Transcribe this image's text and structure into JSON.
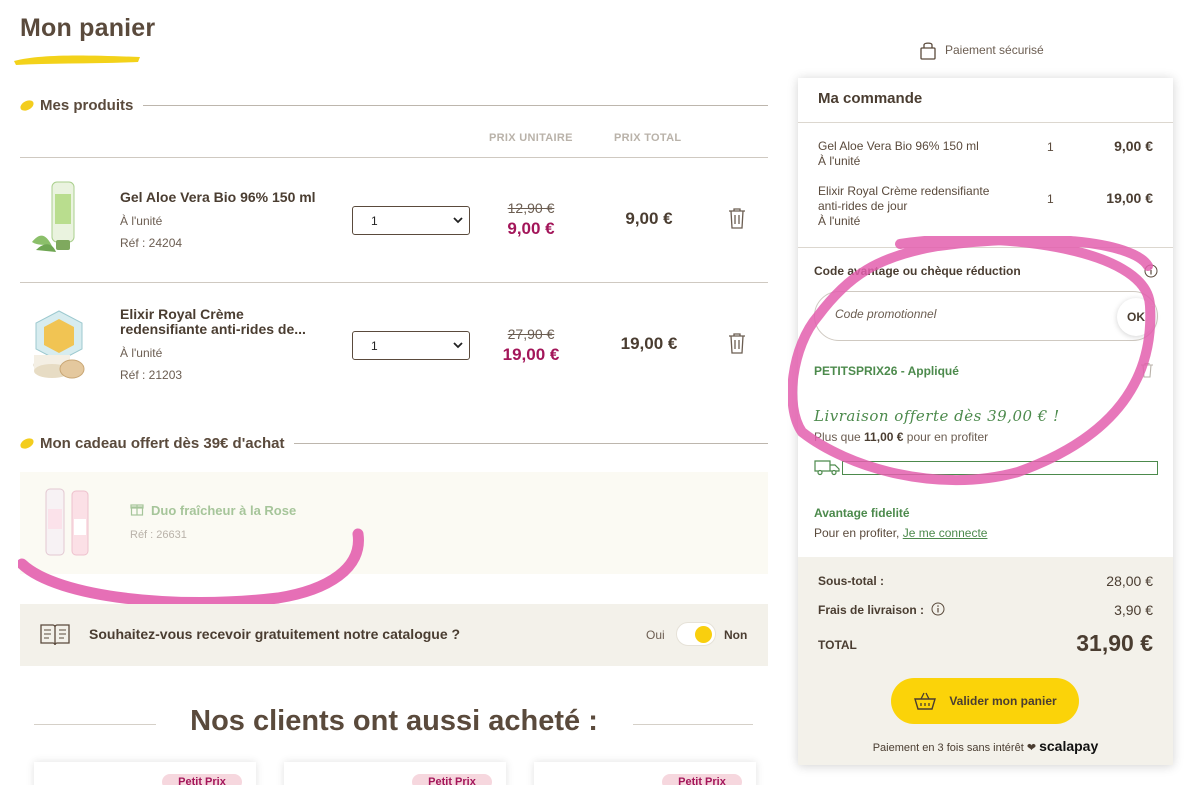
{
  "page": {
    "title": "Mon panier"
  },
  "products_section": {
    "heading": "Mes produits",
    "col_unit_price": "PRIX UNITAIRE",
    "col_total_price": "PRIX TOTAL",
    "items": [
      {
        "name": "Gel Aloe Vera Bio 96% 150 ml",
        "unit": "À l'unité",
        "ref": "Réf : 24204",
        "qty": "1",
        "old_price": "12,90 €",
        "new_price": "9,00 €",
        "total": "9,00 €"
      },
      {
        "name": "Elixir Royal Crème redensifiante anti-rides de...",
        "unit": "À l'unité",
        "ref": "Réf : 21203",
        "qty": "1",
        "old_price": "27,90 €",
        "new_price": "19,00 €",
        "total": "19,00 €"
      }
    ]
  },
  "gift_section": {
    "heading": "Mon cadeau offert dès 39€ d'achat",
    "name": "Duo fraîcheur à la Rose",
    "ref": "Réf : 26631"
  },
  "catalog": {
    "question": "Souhaitez-vous recevoir gratuitement notre catalogue ?",
    "yes": "Oui",
    "no": "Non"
  },
  "also_bought": {
    "title": "Nos clients ont aussi acheté :",
    "badge": "Petit Prix"
  },
  "secure_payment": "Paiement sécurisé",
  "order": {
    "title": "Ma commande",
    "items": [
      {
        "name": "Gel Aloe Vera Bio 96% 150 ml",
        "unit": "À l'unité",
        "qty": "1",
        "price": "9,00 €"
      },
      {
        "name_line1": "Elixir Royal Crème redensifiante",
        "name_line2": "anti-rides de jour",
        "unit": "À l'unité",
        "qty": "1",
        "price": "19,00 €"
      }
    ],
    "promo_label": "Code avantage ou chèque réduction",
    "promo_placeholder": "Code promotionnel",
    "promo_ok": "OK",
    "promo_applied": "PETITSPRIX26 - Appliqué",
    "free_shipping_head": "Livraison offerte dès 39,00 € !",
    "free_shipping_pre": "Plus que",
    "free_shipping_amount": "11,00 €",
    "free_shipping_post": "pour en profiter",
    "shipping_progress": 0,
    "loyalty_title": "Avantage fidelité",
    "loyalty_text": "Pour en profiter,",
    "loyalty_link": "Je me connecte",
    "subtotal_label": "Sous-total :",
    "subtotal_value": "28,00 €",
    "shipping_label": "Frais de livraison :",
    "shipping_value": "3,90 €",
    "total_label": "TOTAL",
    "total_value": "31,90 €",
    "validate_label": "Valider mon panier",
    "installments_text": "Paiement en 3 fois sans intérêt",
    "installments_brand": "scalapay"
  },
  "colors": {
    "brand_brown": "#5a4a3c",
    "accent_yellow": "#fbd309",
    "price_red": "#a3165a",
    "green": "#4c8a4c",
    "annotation_pink": "#e35fae"
  }
}
